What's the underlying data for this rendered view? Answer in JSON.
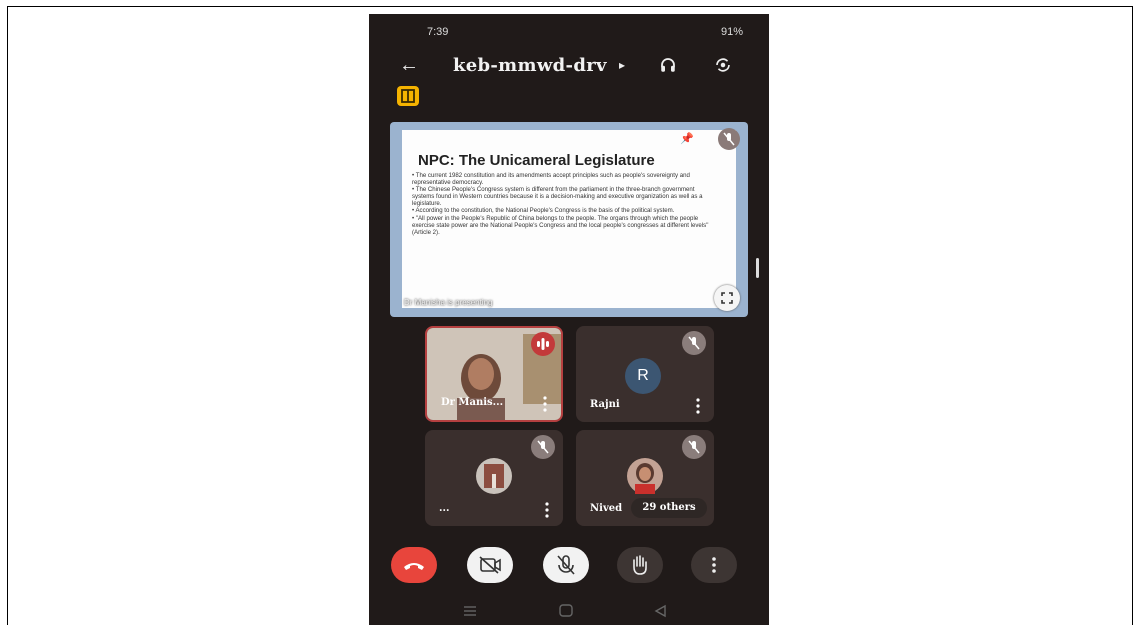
{
  "status_bar": {
    "time": "7:39",
    "battery": "91%"
  },
  "meeting": {
    "code": "keb-mmwd-drv"
  },
  "slide": {
    "title": "NPC: The Unicameral Legislature",
    "bullets": [
      "• The current 1982 constitution and its amendments accept principles such as people's sovereignty and representative democracy.",
      "• The Chinese People's Congress system is different from the parliament in the three-branch government systems found in Western countries because it is a decision-making and executive organization as well as a legislature.",
      "• According to the constitution, the National People's Congress is the basis of the political system.",
      "• \"All power in the People's Republic of China belongs to the people. The organs through which the people exercise state power are the National People's Congress and the local people's congresses at different levels\" (Article 2)."
    ],
    "presenting_label": "Dr Manisha is presenting"
  },
  "participants": [
    {
      "name": "Dr Manis...",
      "type": "video",
      "speaking": true
    },
    {
      "name": "Rajni",
      "type": "avatar",
      "initial": "R",
      "muted": true
    },
    {
      "name": "...",
      "type": "photo",
      "muted": true
    },
    {
      "name": "Nived",
      "type": "photo",
      "muted": true
    }
  ],
  "others_label": "29 others",
  "colors": {
    "phone_bg": "#201a19",
    "end_call": "#e8453c",
    "badge": "#f5b300",
    "avatar": "#3c5672"
  }
}
